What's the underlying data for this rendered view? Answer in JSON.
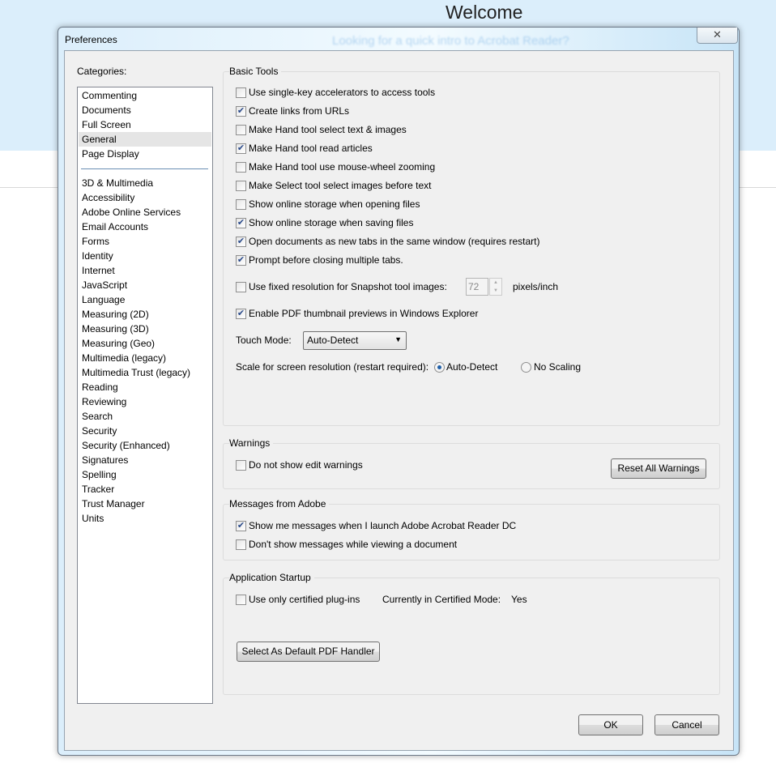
{
  "background": {
    "title": "Welcome",
    "ghost_text": "Looking for a quick intro to Acrobat Reader?"
  },
  "dialog": {
    "title": "Preferences",
    "close_icon": "close-icon"
  },
  "categories": {
    "label": "Categories:",
    "top": [
      "Commenting",
      "Documents",
      "Full Screen",
      "General",
      "Page Display"
    ],
    "selected": "General",
    "items": [
      "3D & Multimedia",
      "Accessibility",
      "Adobe Online Services",
      "Email Accounts",
      "Forms",
      "Identity",
      "Internet",
      "JavaScript",
      "Language",
      "Measuring (2D)",
      "Measuring (3D)",
      "Measuring (Geo)",
      "Multimedia (legacy)",
      "Multimedia Trust (legacy)",
      "Reading",
      "Reviewing",
      "Search",
      "Security",
      "Security (Enhanced)",
      "Signatures",
      "Spelling",
      "Tracker",
      "Trust Manager",
      "Units"
    ]
  },
  "basic_tools": {
    "title": "Basic Tools",
    "options": [
      {
        "label": "Use single-key accelerators to access tools",
        "checked": false
      },
      {
        "label": "Create links from URLs",
        "checked": true
      },
      {
        "label": "Make Hand tool select text & images",
        "checked": false
      },
      {
        "label": "Make Hand tool read articles",
        "checked": true
      },
      {
        "label": "Make Hand tool use mouse-wheel zooming",
        "checked": false
      },
      {
        "label": "Make Select tool select images before text",
        "checked": false
      },
      {
        "label": "Show online storage when opening files",
        "checked": false
      },
      {
        "label": "Show online storage when saving files",
        "checked": true
      },
      {
        "label": "Open documents as new tabs in the same window (requires restart)",
        "checked": true
      },
      {
        "label": "Prompt before closing multiple tabs.",
        "checked": true
      }
    ],
    "snapshot": {
      "label": "Use fixed resolution for Snapshot tool images:",
      "checked": false,
      "value": "72",
      "unit": "pixels/inch"
    },
    "thumbnail": {
      "label": "Enable PDF thumbnail previews in Windows Explorer",
      "checked": true
    },
    "touch_mode": {
      "label": "Touch Mode:",
      "value": "Auto-Detect"
    },
    "scale": {
      "label": "Scale for screen resolution (restart required):",
      "options": [
        "Auto-Detect",
        "No Scaling"
      ],
      "selected": "Auto-Detect"
    }
  },
  "warnings": {
    "title": "Warnings",
    "option": {
      "label": "Do not show edit warnings",
      "checked": false
    },
    "reset_button": "Reset All Warnings"
  },
  "messages": {
    "title": "Messages from Adobe",
    "options": [
      {
        "label": "Show me messages when I launch Adobe Acrobat Reader DC",
        "checked": true
      },
      {
        "label": "Don't show messages while viewing a document",
        "checked": false
      }
    ]
  },
  "startup": {
    "title": "Application Startup",
    "option": {
      "label": "Use only certified plug-ins",
      "checked": false
    },
    "certified_label": "Currently in Certified Mode:",
    "certified_value": "Yes",
    "default_button": "Select As Default PDF Handler"
  },
  "footer": {
    "ok": "OK",
    "cancel": "Cancel"
  }
}
